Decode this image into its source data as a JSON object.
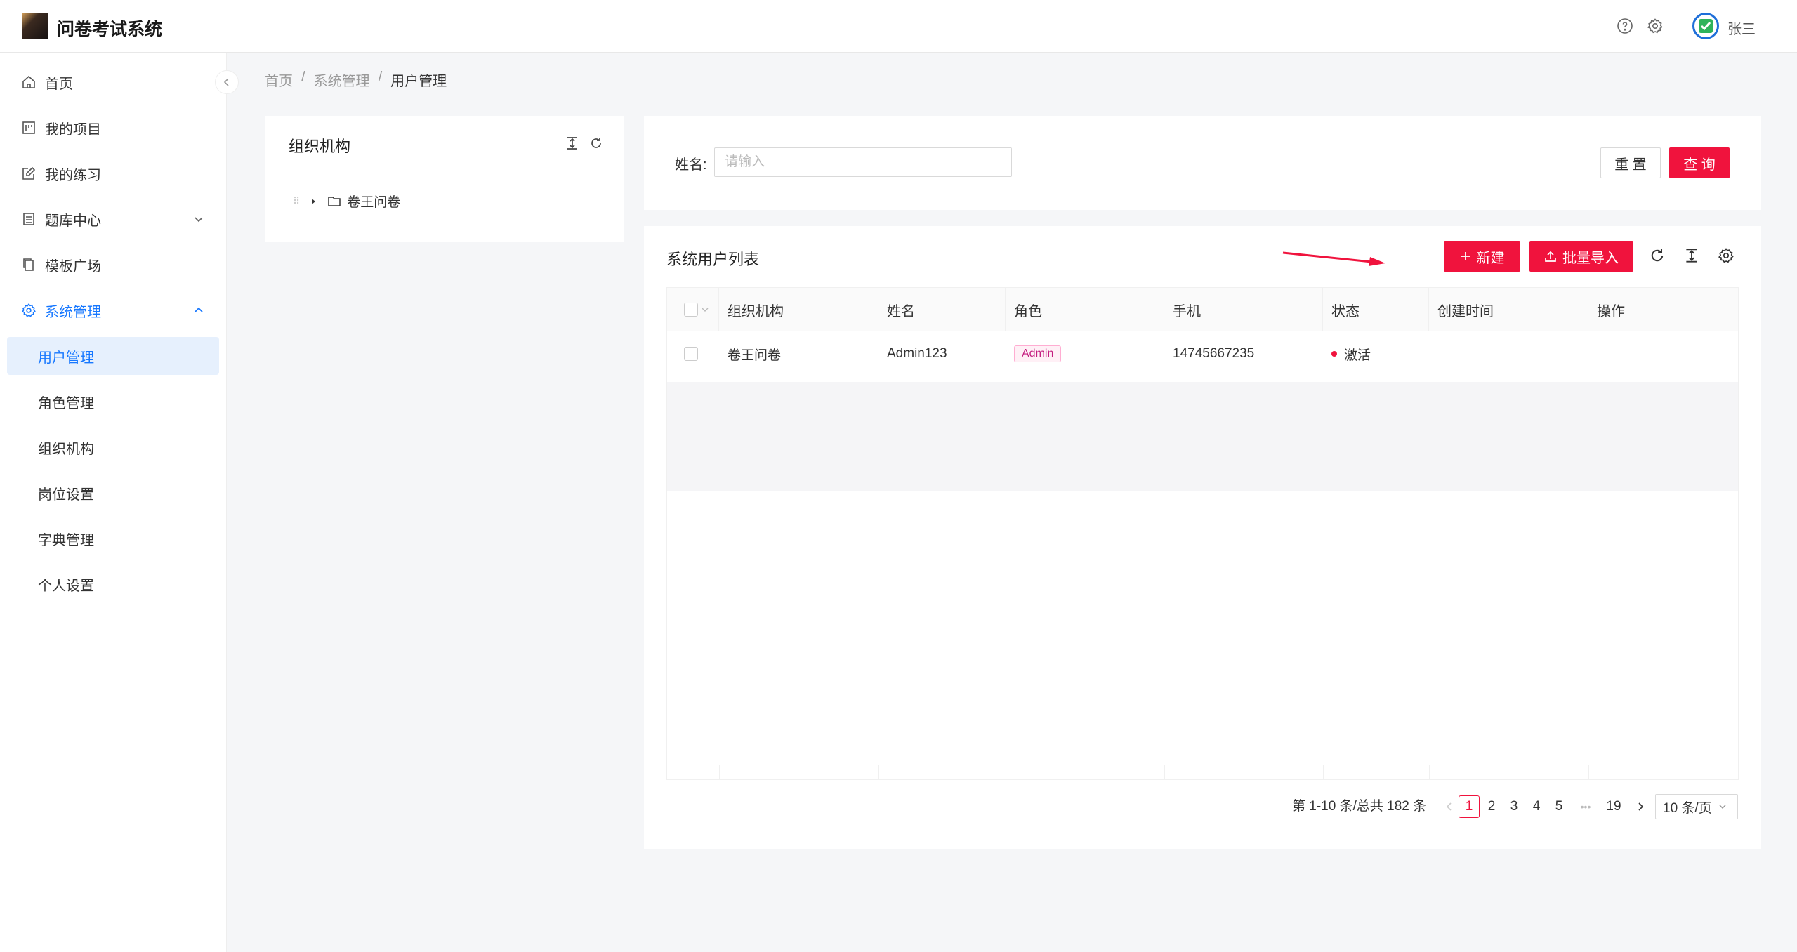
{
  "header": {
    "app_title": "问卷考试系统",
    "username": "张三"
  },
  "sidebar": {
    "items": [
      {
        "label": "首页",
        "icon": "home-icon"
      },
      {
        "label": "我的项目",
        "icon": "project-icon"
      },
      {
        "label": "我的练习",
        "icon": "edit-icon"
      },
      {
        "label": "题库中心",
        "icon": "list-icon"
      },
      {
        "label": "模板广场",
        "icon": "copy-icon"
      },
      {
        "label": "系统管理",
        "icon": "gear-icon"
      }
    ],
    "sub_items": [
      "用户管理",
      "角色管理",
      "组织机构",
      "岗位设置",
      "字典管理",
      "个人设置"
    ]
  },
  "breadcrumb": {
    "home": "首页",
    "sep": "/",
    "parent": "系统管理",
    "current": "用户管理"
  },
  "org_panel": {
    "title": "组织机构",
    "tree_root": "卷王问卷"
  },
  "search": {
    "label": "姓名:",
    "placeholder": "请输入",
    "value": "",
    "reset_label": "重 置",
    "query_label": "查 询"
  },
  "list": {
    "title": "系统用户列表",
    "new_label": "新建",
    "import_label": "批量导入",
    "columns": [
      "组织机构",
      "姓名",
      "角色",
      "手机",
      "状态",
      "创建时间",
      "操作"
    ],
    "rows": [
      {
        "org": "卷王问卷",
        "name": "Admin123",
        "role": "Admin",
        "phone": "14745667235",
        "status": "激活",
        "created": "",
        "actions": ""
      }
    ]
  },
  "pagination": {
    "summary": "第 1-10 条/总共 182 条",
    "pages": [
      "1",
      "2",
      "3",
      "4",
      "5"
    ],
    "ellipsis": "•••",
    "last_page": "19",
    "current": "1",
    "page_size": "10 条/页"
  },
  "colors": {
    "primary": "#f0133d",
    "active_blue": "#1677ff"
  }
}
